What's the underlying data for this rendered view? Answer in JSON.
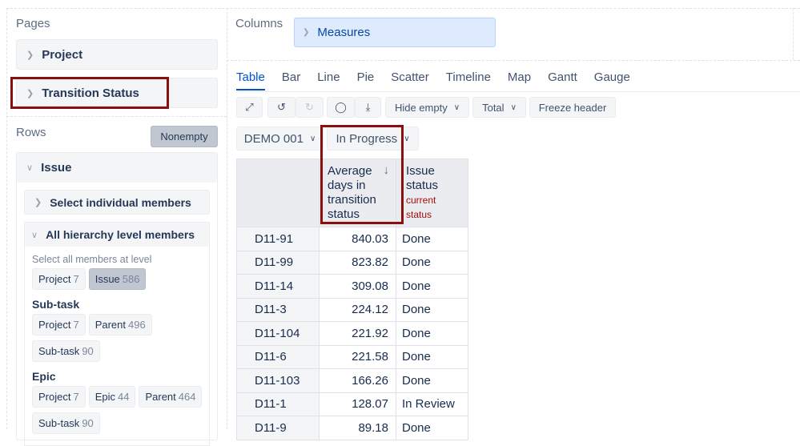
{
  "pages": {
    "title": "Pages",
    "items": [
      "Project",
      "Transition Status"
    ]
  },
  "rows": {
    "title": "Rows",
    "nonempty": "Nonempty",
    "dimension": "Issue",
    "select_individual": "Select individual members",
    "all_hierarchy": "All hierarchy level members",
    "select_all_label": "Select all members at level",
    "level_chips": [
      {
        "label": "Project",
        "count": "7"
      },
      {
        "label": "Issue",
        "count": "586"
      }
    ],
    "groups": [
      {
        "title": "Sub-task",
        "chips": [
          {
            "label": "Project",
            "count": "7"
          },
          {
            "label": "Parent",
            "count": "496"
          },
          {
            "label": "Sub-task",
            "count": "90"
          }
        ]
      },
      {
        "title": "Epic",
        "chips": [
          {
            "label": "Project",
            "count": "7"
          },
          {
            "label": "Epic",
            "count": "44"
          },
          {
            "label": "Parent",
            "count": "464"
          },
          {
            "label": "Sub-task",
            "count": "90"
          }
        ]
      }
    ]
  },
  "columns": {
    "title": "Columns",
    "measures": "Measures"
  },
  "tabs": [
    "Table",
    "Bar",
    "Line",
    "Pie",
    "Scatter",
    "Timeline",
    "Map",
    "Gantt",
    "Gauge"
  ],
  "toolbar": {
    "hide_empty": "Hide empty",
    "total": "Total",
    "freeze": "Freeze header"
  },
  "filters": {
    "project": "DEMO 001",
    "status": "In Progress"
  },
  "table": {
    "col1": "Average days in transition status",
    "col2": "Issue status",
    "col2_note": "current status",
    "rows": [
      [
        "D11-91",
        "840.03",
        "Done"
      ],
      [
        "D11-99",
        "823.82",
        "Done"
      ],
      [
        "D11-14",
        "309.08",
        "Done"
      ],
      [
        "D11-3",
        "224.12",
        "Done"
      ],
      [
        "D11-104",
        "221.92",
        "Done"
      ],
      [
        "D11-6",
        "221.58",
        "Done"
      ],
      [
        "D11-103",
        "166.26",
        "Done"
      ],
      [
        "D11-1",
        "128.07",
        "In Review"
      ],
      [
        "D11-9",
        "89.18",
        "Done"
      ]
    ]
  }
}
